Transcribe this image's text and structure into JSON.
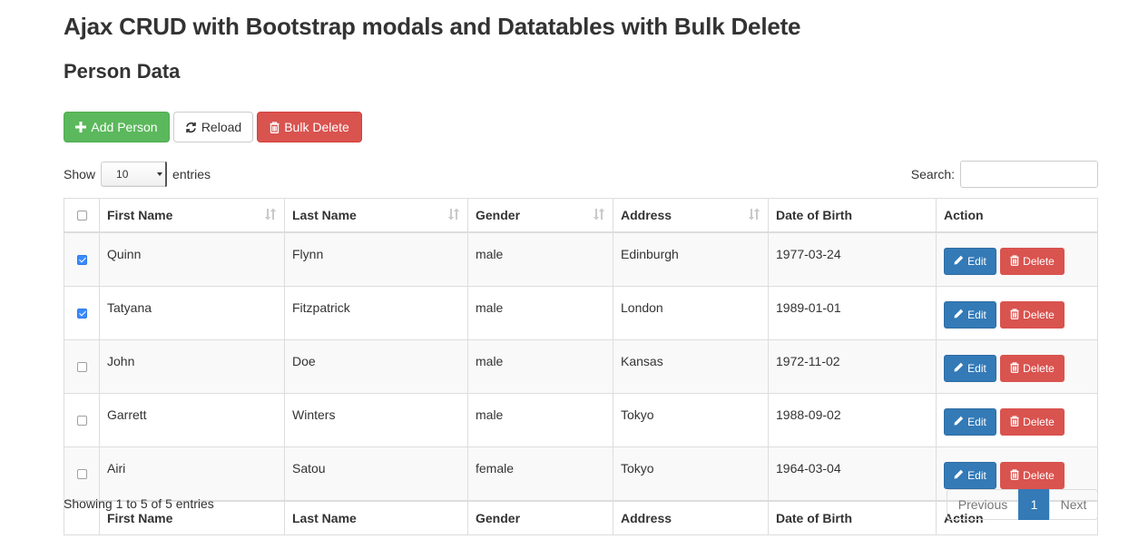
{
  "page": {
    "title": "Ajax CRUD with Bootstrap modals and Datatables with Bulk Delete",
    "subtitle": "Person Data"
  },
  "toolbar": {
    "add_label": "Add Person",
    "reload_label": "Reload",
    "bulk_delete_label": "Bulk Delete"
  },
  "length": {
    "prefix": "Show",
    "selected": "10",
    "suffix": "entries"
  },
  "search": {
    "label": "Search:",
    "value": ""
  },
  "table": {
    "headers": [
      "First Name",
      "Last Name",
      "Gender",
      "Address",
      "Date of Birth",
      "Action"
    ],
    "rows": [
      {
        "checked": true,
        "first": "Quinn",
        "last": "Flynn",
        "gender": "male",
        "address": "Edinburgh",
        "dob": "1977-03-24"
      },
      {
        "checked": true,
        "first": "Tatyana",
        "last": "Fitzpatrick",
        "gender": "male",
        "address": "London",
        "dob": "1989-01-01"
      },
      {
        "checked": false,
        "first": "John",
        "last": "Doe",
        "gender": "male",
        "address": "Kansas",
        "dob": "1972-11-02"
      },
      {
        "checked": false,
        "first": "Garrett",
        "last": "Winters",
        "gender": "male",
        "address": "Tokyo",
        "dob": "1988-09-02"
      },
      {
        "checked": false,
        "first": "Airi",
        "last": "Satou",
        "gender": "female",
        "address": "Tokyo",
        "dob": "1964-03-04"
      }
    ],
    "edit_label": "Edit",
    "delete_label": "Delete"
  },
  "footer": {
    "info": "Showing 1 to 5 of 5 entries",
    "previous": "Previous",
    "current_page": "1",
    "next": "Next"
  },
  "colors": {
    "success": "#5cb85c",
    "danger": "#d9534f",
    "primary": "#337ab7"
  }
}
